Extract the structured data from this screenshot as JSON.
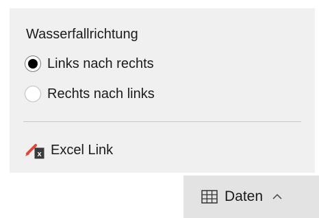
{
  "waterfall": {
    "title": "Wasserfallrichtung",
    "options": [
      {
        "label": "Links nach rechts",
        "selected": true
      },
      {
        "label": "Rechts nach links",
        "selected": false
      }
    ]
  },
  "excel_link": {
    "label": "Excel Link",
    "icon": "excel-link-icon"
  },
  "bottom_tab": {
    "label": "Daten",
    "icon": "table-grid-icon",
    "chevron": "chevron-up-icon"
  },
  "colors": {
    "panel_bg": "#f0f0f0",
    "tab_bg": "#e3e3e3",
    "pencil_accent": "#e0453a"
  }
}
